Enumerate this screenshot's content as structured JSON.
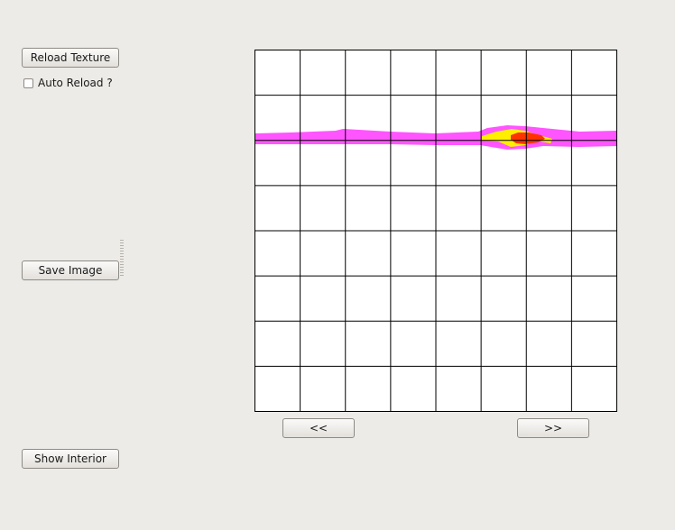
{
  "controls": {
    "reload_texture_label": "Reload Texture",
    "auto_reload_label": "Auto Reload ?",
    "auto_reload_checked": false,
    "save_image_label": "Save Image",
    "show_interior_label": "Show Interior"
  },
  "viewer": {
    "grid_columns": 8,
    "grid_rows": 8,
    "prev_label": "<<",
    "next_label": ">>",
    "colors": {
      "grid_line": "#000000",
      "background": "#ffffff",
      "band": "#ff55ff",
      "hot": "#ffee00",
      "core": "#ff3300"
    }
  }
}
